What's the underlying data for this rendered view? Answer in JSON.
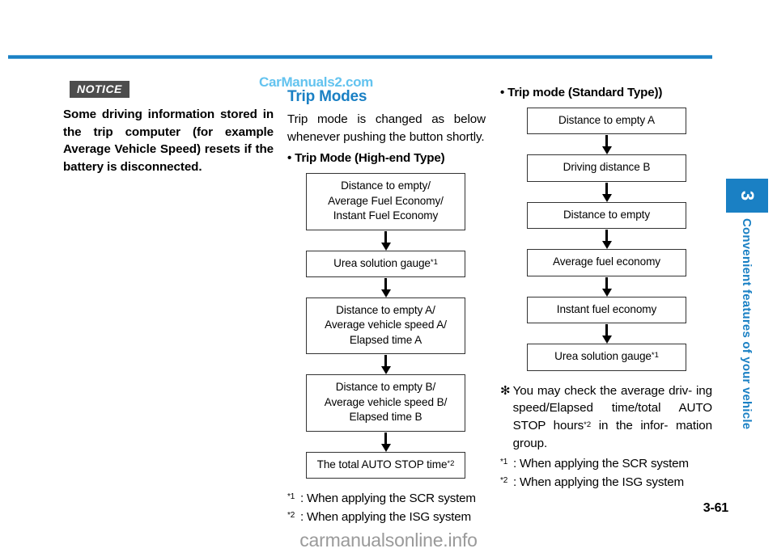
{
  "page": {
    "number": "3-61",
    "rule_color": "#1a80c4"
  },
  "watermarks": {
    "top": "CarManuals2.com",
    "bottom": "carmanualsonline.info"
  },
  "chapter_tab": {
    "number": "3",
    "title": "Convenient features of your vehicle",
    "color": "#1a80c4"
  },
  "notice": {
    "badge": "NOTICE",
    "text": "Some driving information stored in the trip computer (for example Average Vehicle Speed) resets if the battery is disconnected."
  },
  "trip_modes": {
    "heading": "Trip Modes",
    "intro": "Trip mode is changed as below whenever pushing the button shortly.",
    "high_end": {
      "bullet_label": "Trip Mode (High-end Type)",
      "boxes": [
        {
          "lines": [
            "Distance to empty/",
            "Average Fuel Economy/",
            "Instant Fuel Economy"
          ],
          "mark": ""
        },
        {
          "lines": [
            "Urea solution gauge"
          ],
          "mark": "*1"
        },
        {
          "lines": [
            "Distance to empty A/",
            "Average vehicle speed A/",
            "Elapsed time A"
          ],
          "mark": ""
        },
        {
          "lines": [
            "Distance to empty B/",
            "Average vehicle speed B/",
            "Elapsed time B"
          ],
          "mark": ""
        },
        {
          "lines": [
            "The total AUTO STOP time"
          ],
          "mark": "*2"
        }
      ],
      "footnotes": [
        {
          "mark": "*1",
          "text": ": When applying the SCR system"
        },
        {
          "mark": "*2",
          "text": ": When applying the ISG system"
        }
      ]
    },
    "standard": {
      "bullet_label": "Trip mode (Standard Type))",
      "boxes": [
        {
          "lines": [
            "Distance to empty A"
          ],
          "mark": ""
        },
        {
          "lines": [
            "Driving distance B"
          ],
          "mark": ""
        },
        {
          "lines": [
            "Distance to empty"
          ],
          "mark": ""
        },
        {
          "lines": [
            "Average fuel economy"
          ],
          "mark": ""
        },
        {
          "lines": [
            "Instant fuel economy"
          ],
          "mark": ""
        },
        {
          "lines": [
            "Urea solution gauge"
          ],
          "mark": "*1"
        }
      ],
      "note": {
        "mark": "✻",
        "line1": "You may check the average driv-",
        "line2": "ing speed/Elapsed time/total",
        "line3_a": "AUTO STOP hours",
        "line3_mark": "*2",
        "line3_b": " in the infor-",
        "line4": "mation group."
      },
      "footnotes": [
        {
          "mark": "*1",
          "text": ": When applying the SCR system"
        },
        {
          "mark": "*2",
          "text": ": When applying the ISG system"
        }
      ]
    }
  }
}
